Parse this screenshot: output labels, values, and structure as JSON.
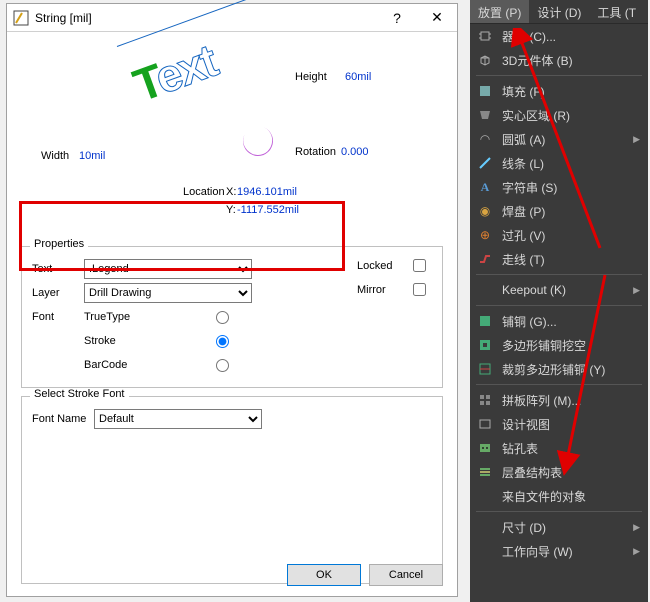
{
  "dialog": {
    "title": "String  [mil]",
    "preview": {
      "text": "Text",
      "height_label": "Height",
      "height_value": "60mil",
      "width_label": "Width",
      "width_value": "10mil",
      "rotation_label": "Rotation",
      "rotation_value": "0.000",
      "location_label": "Location",
      "x_label": "X:",
      "x_value": "1946.101mil",
      "y_label": "Y:",
      "y_value": "-1117.552mil"
    },
    "properties": {
      "legend": "Properties",
      "text_label": "Text",
      "text_value": ".Legend",
      "layer_label": "Layer",
      "layer_value": "Drill Drawing",
      "locked_label": "Locked",
      "locked_checked": false,
      "mirror_label": "Mirror",
      "mirror_checked": false,
      "font_label": "Font",
      "font_options": {
        "truetype": "TrueType",
        "stroke": "Stroke",
        "barcode": "BarCode"
      },
      "font_selected": "stroke"
    },
    "stroke": {
      "legend": "Select Stroke Font",
      "fontname_label": "Font Name",
      "fontname_value": "Default"
    },
    "buttons": {
      "ok": "OK",
      "cancel": "Cancel"
    }
  },
  "panel": {
    "menubar": [
      {
        "label": "放置",
        "key": "(P)",
        "active": true
      },
      {
        "label": "设计",
        "key": "(D)",
        "active": false
      },
      {
        "label": "工具",
        "key": "(T",
        "active": false
      }
    ],
    "items": [
      {
        "icon": "chip-icon",
        "label": "器件 (C)...",
        "sub": false
      },
      {
        "icon": "cube-icon",
        "label": "3D元件体 (B)",
        "sub": false
      },
      {
        "sep": true
      },
      {
        "icon": "fill-icon",
        "label": "填充 (F)",
        "sub": false
      },
      {
        "icon": "region-icon",
        "label": "实心区域 (R)",
        "sub": false
      },
      {
        "icon": "arc-icon",
        "label": "圆弧 (A)",
        "sub": true
      },
      {
        "icon": "line-icon",
        "label": "线条 (L)",
        "sub": false
      },
      {
        "icon": "text-icon",
        "label": "字符串 (S)",
        "sub": false
      },
      {
        "icon": "pad-icon",
        "label": "焊盘 (P)",
        "sub": false
      },
      {
        "icon": "via-icon",
        "label": "过孔 (V)",
        "sub": false
      },
      {
        "icon": "track-icon",
        "label": "走线 (T)",
        "sub": false
      },
      {
        "sep": true
      },
      {
        "icon": "",
        "label": "Keepout (K)",
        "sub": true
      },
      {
        "sep": true
      },
      {
        "icon": "poly-icon",
        "label": "铺铜 (G)...",
        "sub": false
      },
      {
        "icon": "polycut-icon",
        "label": "多边形铺铜挖空",
        "sub": false
      },
      {
        "icon": "polycrop-icon",
        "label": "裁剪多边形铺铜 (Y)",
        "sub": false
      },
      {
        "sep": true
      },
      {
        "icon": "panel-icon",
        "label": "拼板阵列 (M)...",
        "sub": false
      },
      {
        "icon": "view-icon",
        "label": "设计视图",
        "sub": false
      },
      {
        "icon": "drill-icon",
        "label": "钻孔表",
        "sub": false
      },
      {
        "icon": "stack-icon",
        "label": "层叠结构表",
        "sub": false
      },
      {
        "icon": "",
        "label": "来自文件的对象",
        "sub": false
      },
      {
        "sep": true
      },
      {
        "icon": "",
        "label": "尺寸 (D)",
        "sub": true
      },
      {
        "icon": "",
        "label": "工作向导 (W)",
        "sub": true
      }
    ]
  }
}
